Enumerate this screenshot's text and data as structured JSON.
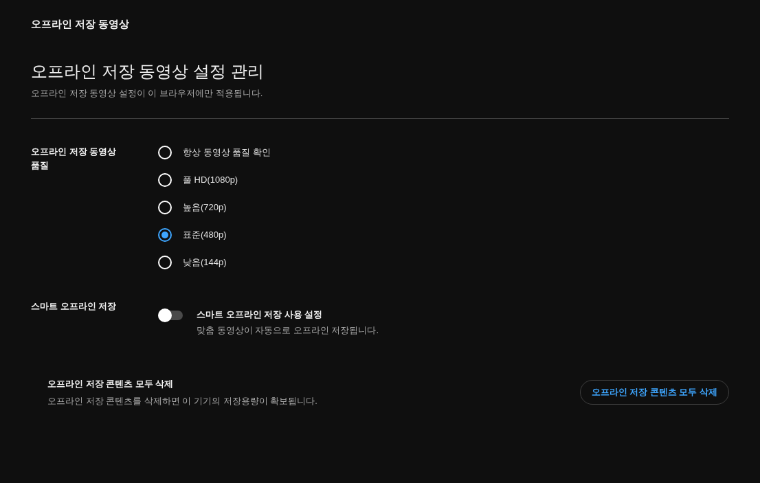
{
  "header": {
    "title": "오프라인 저장 동영상"
  },
  "page": {
    "title": "오프라인 저장 동영상 설정 관리",
    "subtitle": "오프라인 저장 동영상 설정이 이 브라우저에만 적용됩니다."
  },
  "quality": {
    "label": "오프라인 저장 동영상 품질",
    "options": [
      {
        "label": "항상 동영상 품질 확인",
        "selected": false
      },
      {
        "label": "풀 HD(1080p)",
        "selected": false
      },
      {
        "label": "높음(720p)",
        "selected": false
      },
      {
        "label": "표준(480p)",
        "selected": true
      },
      {
        "label": "낮음(144p)",
        "selected": false
      }
    ]
  },
  "smart": {
    "label": "스마트 오프라인 저장",
    "toggle_title": "스마트 오프라인 저장 사용 설정",
    "toggle_description": "맞춤 동영상이 자동으로 오프라인 저장됩니다.",
    "on": false
  },
  "delete": {
    "title": "오프라인 저장 콘텐츠 모두 삭제",
    "description": "오프라인 저장 콘텐츠를 삭제하면 이 기기의 저장용량이 확보됩니다.",
    "button": "오프라인 저장 콘텐츠 모두 삭제"
  }
}
